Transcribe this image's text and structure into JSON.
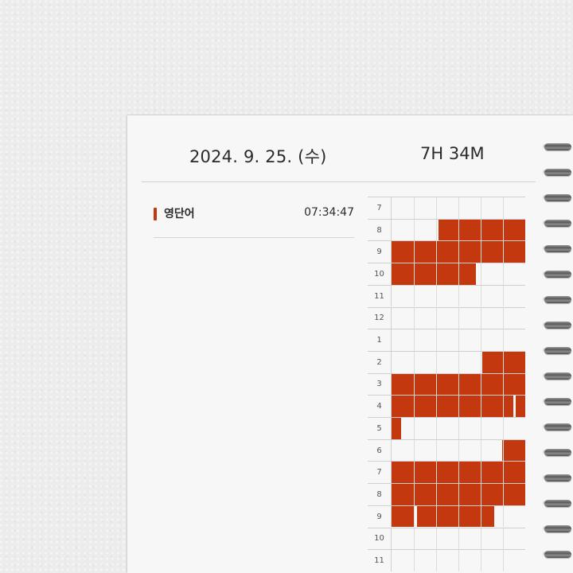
{
  "header": {
    "date": "2024. 9. 25. (수)",
    "total_time": "7H 34M"
  },
  "subjects": [
    {
      "name": "영단어",
      "time": "07:34:47",
      "color": "#c3380f"
    }
  ],
  "timeline": {
    "hours": [
      "7",
      "8",
      "9",
      "10",
      "11",
      "12",
      "1",
      "2",
      "3",
      "4",
      "5",
      "6",
      "7",
      "8",
      "9",
      "10",
      "11"
    ],
    "fill_color": "#c3380f",
    "studied_fraction_by_row": [
      [],
      [
        [
          0.35,
          1.0
        ]
      ],
      [
        [
          0.0,
          1.0
        ]
      ],
      [
        [
          0.0,
          0.63
        ]
      ],
      [],
      [],
      [],
      [
        [
          0.68,
          1.0
        ]
      ],
      [
        [
          0.0,
          1.0
        ]
      ],
      [
        [
          0.0,
          0.91
        ],
        [
          0.93,
          1.0
        ]
      ],
      [
        [
          0.0,
          0.07
        ]
      ],
      [
        [
          0.83,
          1.0
        ]
      ],
      [
        [
          0.0,
          1.0
        ]
      ],
      [
        [
          0.0,
          1.0
        ]
      ],
      [
        [
          0.0,
          0.17
        ],
        [
          0.19,
          0.77
        ]
      ],
      [],
      []
    ]
  }
}
